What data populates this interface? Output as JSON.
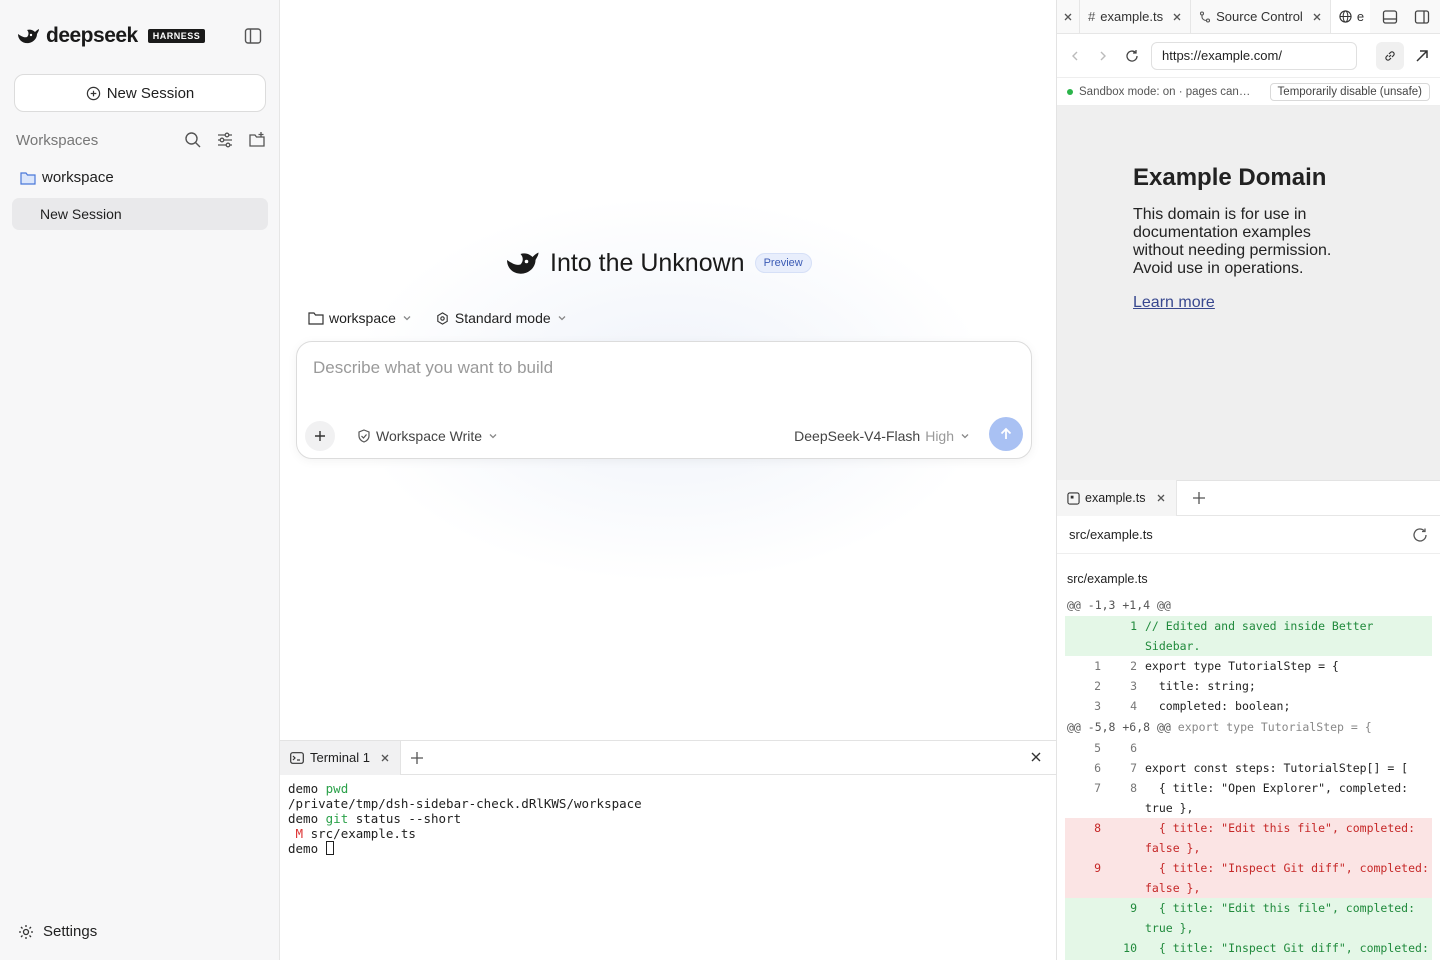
{
  "sidebar": {
    "logo_text": "deepseek",
    "logo_badge": "HARNESS",
    "new_session_label": "New Session",
    "workspaces_title": "Workspaces",
    "workspace_name": "workspace",
    "session_name": "New Session",
    "settings_label": "Settings"
  },
  "main": {
    "hero_title": "Into the Unknown",
    "preview_badge": "Preview",
    "workspace_select": "workspace",
    "mode_select": "Standard mode",
    "composer_placeholder": "Describe what you want to build",
    "permission": "Workspace Write",
    "model": "DeepSeek-V4-Flash",
    "effort": "High"
  },
  "terminal": {
    "tab_label": "Terminal 1",
    "lines": [
      {
        "prompt": "demo",
        "cmd": "pwd",
        "args": ""
      },
      {
        "out": "/private/tmp/dsh-sidebar-check.dRlKWS/workspace"
      },
      {
        "prompt": "demo",
        "cmd": "git",
        "args": "status --short"
      },
      {
        "flag": "M",
        "out": "src/example.ts"
      },
      {
        "prompt": "demo",
        "cursor": true
      }
    ]
  },
  "right": {
    "tabs": [
      {
        "label": "example.ts",
        "icon": "hash-icon"
      },
      {
        "label": "Source Control",
        "icon": "git-branch-icon"
      },
      {
        "label": "e",
        "icon": "globe-icon"
      }
    ],
    "url": "https://example.com/",
    "sandbox_text": "Sandbox mode: on · pages can…",
    "unsafe_button": "Temporarily disable (unsafe)",
    "web": {
      "heading": "Example Domain",
      "paragraph": "This domain is for use in documentation examples without needing permission. Avoid use in operations.",
      "link": "Learn more"
    },
    "file_tab": "example.ts",
    "file_path": "src/example.ts",
    "diff": {
      "file": "src/example.ts",
      "hunk1": "@@ -1,3 +1,4 @@",
      "hunk2": "@@ -5,8 +6,8 @@",
      "hunk2_ctx": "export type TutorialStep = {",
      "lines1": [
        {
          "type": "add",
          "old": "",
          "new": "1",
          "code": "// Edited and saved inside Better Sidebar."
        },
        {
          "type": "ctx",
          "old": "1",
          "new": "2",
          "code": "export type TutorialStep = {"
        },
        {
          "type": "ctx",
          "old": "2",
          "new": "3",
          "code": "  title: string;"
        },
        {
          "type": "ctx",
          "old": "3",
          "new": "4",
          "code": "  completed: boolean;"
        }
      ],
      "lines2": [
        {
          "type": "ctx",
          "old": "5",
          "new": "6",
          "code": ""
        },
        {
          "type": "ctx",
          "old": "6",
          "new": "7",
          "code": "export const steps: TutorialStep[] = ["
        },
        {
          "type": "ctx",
          "old": "7",
          "new": "8",
          "code": "  { title: \"Open Explorer\", completed: true },"
        },
        {
          "type": "del",
          "old": "8",
          "new": "",
          "code": "  { title: \"Edit this file\", completed: false },"
        },
        {
          "type": "del",
          "old": "9",
          "new": "",
          "code": "  { title: \"Inspect Git diff\", completed: false },"
        },
        {
          "type": "add",
          "old": "",
          "new": "9",
          "code": "  { title: \"Edit this file\", completed: true },"
        },
        {
          "type": "add",
          "old": "",
          "new": "10",
          "code": "  { title: \"Inspect Git diff\", completed: true },"
        }
      ]
    }
  },
  "colors": {
    "accent": "#a9c1f3",
    "add_bg": "#e4f7e7",
    "del_bg": "#fbe4e4",
    "sandbox_dot": "#2bb44a"
  }
}
